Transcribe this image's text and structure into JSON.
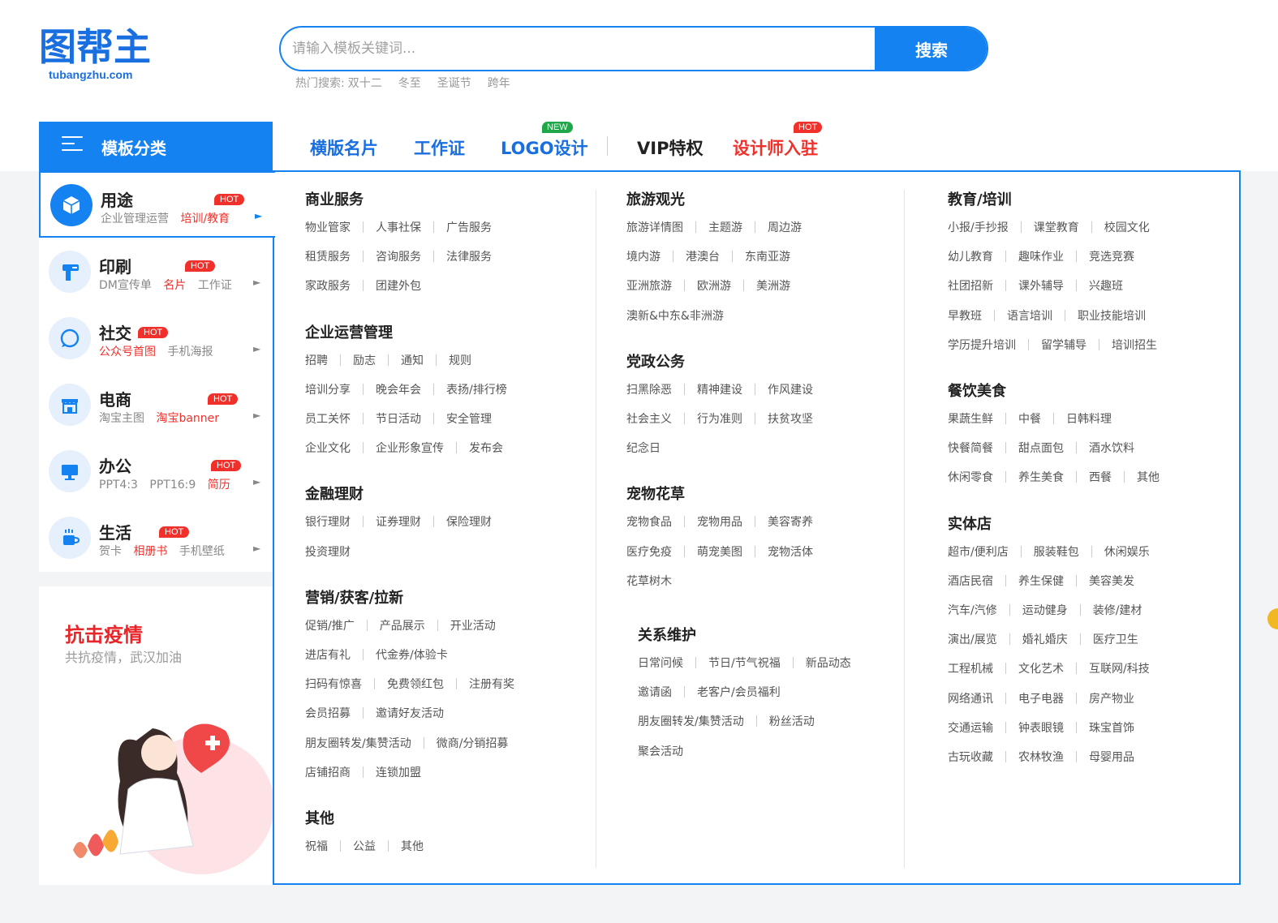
{
  "logo": {
    "main": "图帮主",
    "sub": "tubangzhu.com"
  },
  "search": {
    "placeholder": "请输入模板关键词...",
    "button": "搜索"
  },
  "hot_search": {
    "label": "热门搜索:",
    "items": [
      "双十二",
      "冬至",
      "圣诞节",
      "跨年"
    ]
  },
  "nav": {
    "category_label": "模板分类",
    "links": [
      "横版名片",
      "工作证",
      "LOGO设计",
      "VIP特权",
      "设计师入驻"
    ],
    "badges": {
      "new": "NEW",
      "hot": "HOT"
    }
  },
  "sidebar": [
    {
      "title": "用途",
      "hot": "HOT",
      "sub": [
        "企业管理运营",
        "培训/教育"
      ],
      "red": [
        1
      ]
    },
    {
      "title": "印刷",
      "hot": "HOT",
      "sub": [
        "DM宣传单",
        "名片",
        "工作证"
      ],
      "red": [
        1
      ]
    },
    {
      "title": "社交",
      "hot": "HOT",
      "sub": [
        "公众号首图",
        "手机海报"
      ],
      "red": [
        0
      ]
    },
    {
      "title": "电商",
      "hot": "HOT",
      "sub": [
        "淘宝主图",
        "淘宝banner"
      ],
      "red": [
        1
      ]
    },
    {
      "title": "办公",
      "hot": "HOT",
      "sub": [
        "PPT4:3",
        "PPT16:9",
        "简历"
      ],
      "red": [
        2
      ]
    },
    {
      "title": "生活",
      "hot": "HOT",
      "sub": [
        "贺卡",
        "相册书",
        "手机壁纸"
      ],
      "red": [
        1
      ]
    }
  ],
  "banner": {
    "title": "抗击疫情",
    "subtitle": "共抗疫情，武汉加油"
  },
  "columns": [
    [
      {
        "title": "商业服务",
        "rows": [
          [
            "物业管家",
            "人事社保",
            "广告服务"
          ],
          [
            "租赁服务",
            "咨询服务",
            "法律服务"
          ],
          [
            "家政服务",
            "团建外包"
          ]
        ]
      },
      {
        "title": "企业运营管理",
        "rows": [
          [
            "招聘",
            "励志",
            "通知",
            "规则"
          ],
          [
            "培训分享",
            "晚会年会",
            "表扬/排行榜"
          ],
          [
            "员工关怀",
            "节日活动",
            "安全管理"
          ],
          [
            "企业文化",
            "企业形象宣传",
            "发布会"
          ]
        ]
      },
      {
        "title": "金融理财",
        "rows": [
          [
            "银行理财",
            "证券理财",
            "保险理财"
          ],
          [
            "投资理财"
          ]
        ]
      },
      {
        "title": "营销/获客/拉新",
        "rows": [
          [
            "促销/推广",
            "产品展示",
            "开业活动"
          ],
          [
            "进店有礼",
            "代金券/体验卡"
          ],
          [
            "扫码有惊喜",
            "免费领红包",
            "注册有奖"
          ],
          [
            "会员招募",
            "邀请好友活动"
          ],
          [
            "朋友圈转发/集赞活动",
            "微商/分销招募"
          ],
          [
            "店铺招商",
            "连锁加盟"
          ]
        ]
      },
      {
        "title": "其他",
        "rows": [
          [
            "祝福",
            "公益",
            "其他"
          ]
        ]
      }
    ],
    [
      {
        "title": "旅游观光",
        "rows": [
          [
            "旅游详情图",
            "主题游",
            "周边游"
          ],
          [
            "境内游",
            "港澳台",
            "东南亚游"
          ],
          [
            "亚洲旅游",
            "欧洲游",
            "美洲游"
          ],
          [
            "澳新&中东&非洲游"
          ]
        ]
      },
      {
        "title": "党政公务",
        "rows": [
          [
            "扫黑除恶",
            "精神建设",
            "作风建设"
          ],
          [
            "社会主义",
            "行为准则",
            "扶贫攻坚"
          ],
          [
            "纪念日"
          ]
        ]
      },
      {
        "title": "宠物花草",
        "rows": [
          [
            "宠物食品",
            "宠物用品",
            "美容寄养"
          ],
          [
            "医疗免疫",
            "萌宠美图",
            "宠物活体"
          ],
          [
            "花草树木"
          ]
        ]
      },
      {
        "title": "关系维护",
        "rows": [
          [
            "日常问候",
            "节日/节气祝福",
            "新品动态"
          ],
          [
            "邀请函",
            "老客户/会员福利"
          ],
          [
            "朋友圈转发/集赞活动",
            "粉丝活动"
          ],
          [
            "聚会活动"
          ]
        ]
      }
    ],
    [
      {
        "title": "教育/培训",
        "rows": [
          [
            "小报/手抄报",
            "课堂教育",
            "校园文化"
          ],
          [
            "幼儿教育",
            "趣味作业",
            "竞选竞赛"
          ],
          [
            "社团招新",
            "课外辅导",
            "兴趣班"
          ],
          [
            "早教班",
            "语言培训",
            "职业技能培训"
          ],
          [
            "学历提升培训",
            "留学辅导",
            "培训招生"
          ]
        ]
      },
      {
        "title": "餐饮美食",
        "rows": [
          [
            "果蔬生鲜",
            "中餐",
            "日韩料理"
          ],
          [
            "快餐简餐",
            "甜点面包",
            "酒水饮料"
          ],
          [
            "休闲零食",
            "养生美食",
            "西餐",
            "其他"
          ]
        ]
      },
      {
        "title": "实体店",
        "rows": [
          [
            "超市/便利店",
            "服装鞋包",
            "休闲娱乐"
          ],
          [
            "酒店民宿",
            "养生保健",
            "美容美发"
          ],
          [
            "汽车/汽修",
            "运动健身",
            "装修/建材"
          ],
          [
            "演出/展览",
            "婚礼婚庆",
            "医疗卫生"
          ],
          [
            "工程机械",
            "文化艺术",
            "互联网/科技"
          ],
          [
            "网络通讯",
            "电子电器",
            "房产物业"
          ],
          [
            "交通运输",
            "钟表眼镜",
            "珠宝首饰"
          ],
          [
            "古玩收藏",
            "农林牧渔",
            "母婴用品"
          ]
        ]
      }
    ]
  ]
}
